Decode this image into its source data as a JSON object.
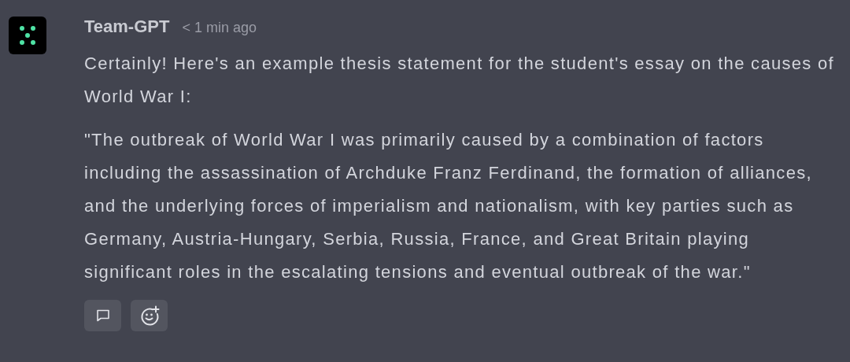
{
  "message": {
    "author": "Team-GPT",
    "time": "< 1 min ago",
    "paragraphs": [
      "Certainly! Here's an example thesis statement for the student's essay on the causes of World War I:",
      "\"The outbreak of World War I was primarily caused by a combination of factors including the assassination of Archduke Franz Ferdinand, the formation of alliances, and the underlying forces of imperialism and nationalism, with key parties such as Germany, Austria-Hungary, Serbia, Russia, France, and Great Britain playing significant roles in the escalating tensions and eventual outbreak of the war.\""
    ],
    "actions": [
      {
        "kind": "comment"
      },
      {
        "kind": "react"
      }
    ]
  }
}
